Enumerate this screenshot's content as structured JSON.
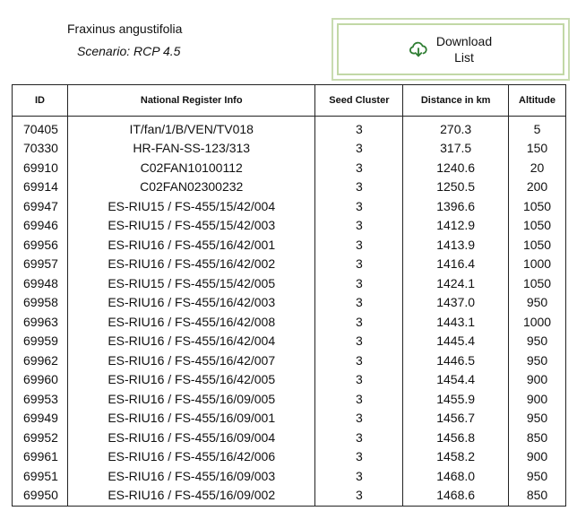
{
  "header": {
    "species": "Fraxinus angustifolia",
    "scenario": "Scenario: RCP 4.5"
  },
  "download_button": {
    "label": "Download List",
    "icon": "cloud-download-icon",
    "icon_color": "#2e7d32"
  },
  "table": {
    "columns": [
      "ID",
      "National Register Info",
      "Seed Cluster",
      "Distance in km",
      "Altitude"
    ],
    "rows": [
      [
        "70405",
        "IT/fan/1/B/VEN/TV018",
        "3",
        "270.3",
        "5"
      ],
      [
        "70330",
        "HR-FAN-SS-123/313",
        "3",
        "317.5",
        "150"
      ],
      [
        "69910",
        "C02FAN10100112",
        "3",
        "1240.6",
        "20"
      ],
      [
        "69914",
        "C02FAN02300232",
        "3",
        "1250.5",
        "200"
      ],
      [
        "69947",
        "ES-RIU15 / FS-455/15/42/004",
        "3",
        "1396.6",
        "1050"
      ],
      [
        "69946",
        "ES-RIU15 / FS-455/15/42/003",
        "3",
        "1412.9",
        "1050"
      ],
      [
        "69956",
        "ES-RIU16 / FS-455/16/42/001",
        "3",
        "1413.9",
        "1050"
      ],
      [
        "69957",
        "ES-RIU16 / FS-455/16/42/002",
        "3",
        "1416.4",
        "1000"
      ],
      [
        "69948",
        "ES-RIU15 / FS-455/15/42/005",
        "3",
        "1424.1",
        "1050"
      ],
      [
        "69958",
        "ES-RIU16 / FS-455/16/42/003",
        "3",
        "1437.0",
        "950"
      ],
      [
        "69963",
        "ES-RIU16 / FS-455/16/42/008",
        "3",
        "1443.1",
        "1000"
      ],
      [
        "69959",
        "ES-RIU16 / FS-455/16/42/004",
        "3",
        "1445.4",
        "950"
      ],
      [
        "69962",
        "ES-RIU16 / FS-455/16/42/007",
        "3",
        "1446.5",
        "950"
      ],
      [
        "69960",
        "ES-RIU16 / FS-455/16/42/005",
        "3",
        "1454.4",
        "900"
      ],
      [
        "69953",
        "ES-RIU16 / FS-455/16/09/005",
        "3",
        "1455.9",
        "900"
      ],
      [
        "69949",
        "ES-RIU16 / FS-455/16/09/001",
        "3",
        "1456.7",
        "950"
      ],
      [
        "69952",
        "ES-RIU16 / FS-455/16/09/004",
        "3",
        "1456.8",
        "850"
      ],
      [
        "69961",
        "ES-RIU16 / FS-455/16/42/006",
        "3",
        "1458.2",
        "900"
      ],
      [
        "69951",
        "ES-RIU16 / FS-455/16/09/003",
        "3",
        "1468.0",
        "950"
      ],
      [
        "69950",
        "ES-RIU16 / FS-455/16/09/002",
        "3",
        "1468.6",
        "850"
      ]
    ]
  }
}
